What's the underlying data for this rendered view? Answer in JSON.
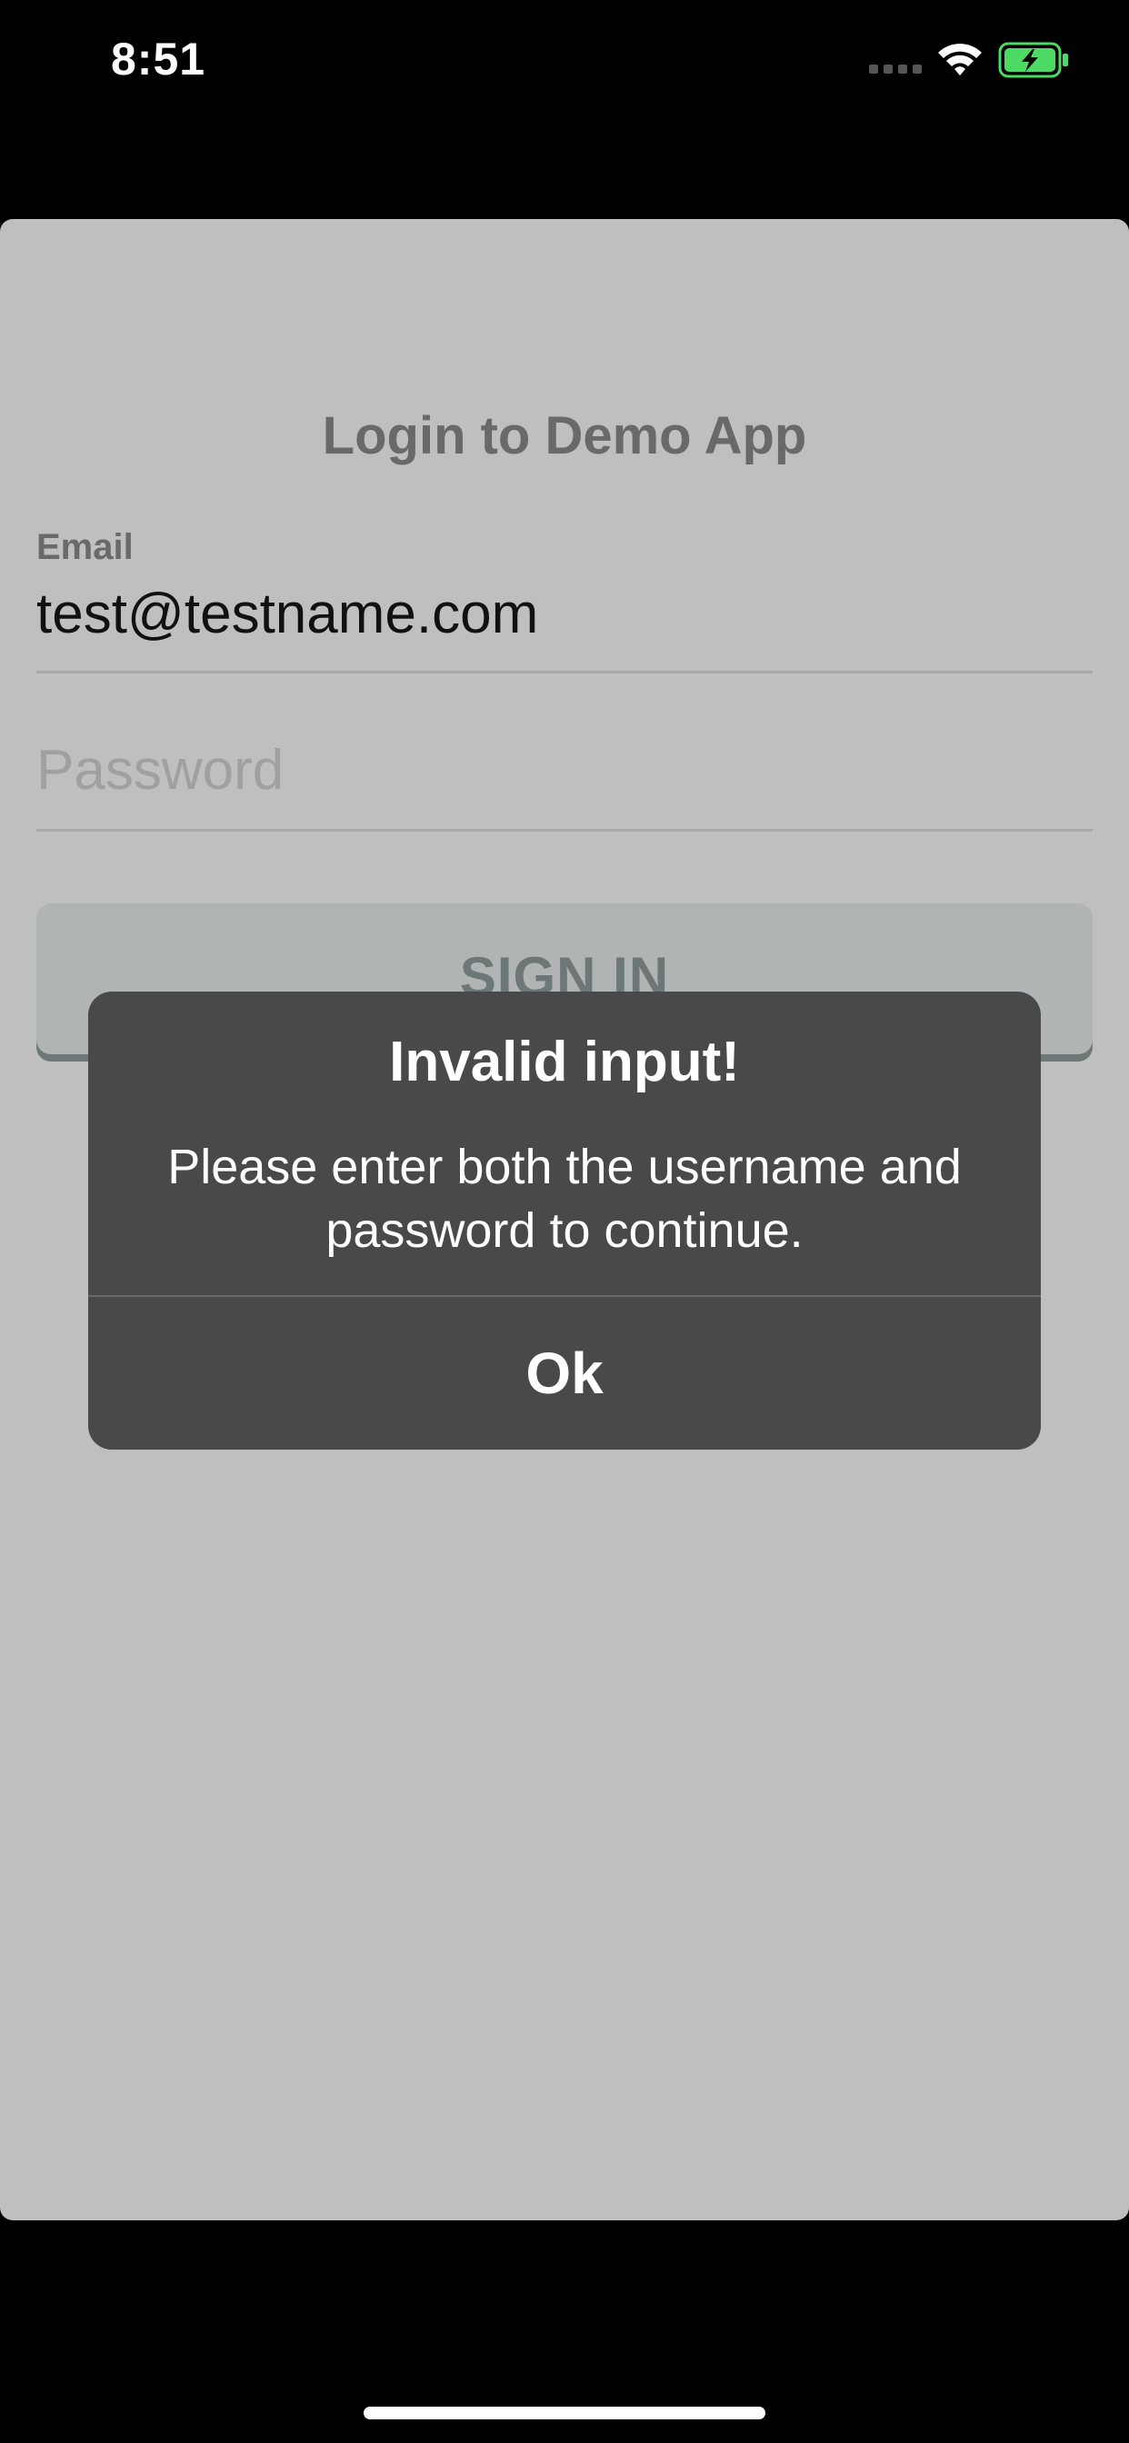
{
  "status_bar": {
    "time": "8:51",
    "icons": [
      "signal-icon",
      "wifi-icon",
      "battery-charging-icon"
    ],
    "battery_color": "#4cd964"
  },
  "login": {
    "title": "Login to Demo App",
    "email_label": "Email",
    "email_value": "test@testname.com",
    "password_placeholder": "Password",
    "sign_in_label": "SIGN IN"
  },
  "alert": {
    "title": "Invalid input!",
    "message": "Please enter both the username and password to continue.",
    "ok_label": "Ok"
  }
}
